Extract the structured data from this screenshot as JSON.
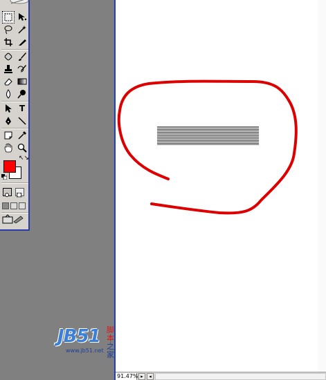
{
  "statusbar": {
    "zoom": "91.47%"
  },
  "watermark": {
    "logo": "JB51",
    "cn_line1": "脚本",
    "cn_line2": "之家",
    "url": "www.jb51.net"
  },
  "toolbox": {
    "foreground_color": "#ff0000",
    "background_color": "#ffffff",
    "type_tool_glyph": "T"
  },
  "colors": {
    "workspace": "#808080",
    "annotation": "#dd0000",
    "window_border": "#1c3fbf"
  }
}
